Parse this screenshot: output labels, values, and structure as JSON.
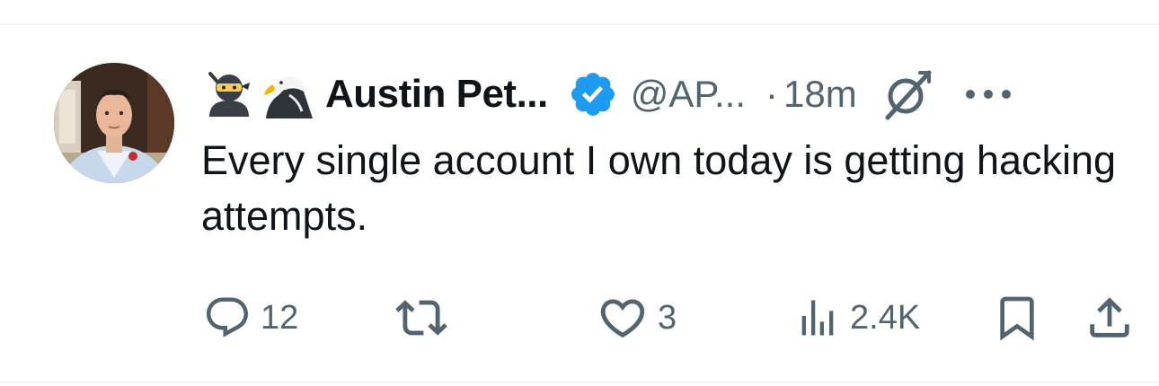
{
  "tweet": {
    "display_name": "Austin Pet...",
    "handle": "@AP...",
    "separator": "·",
    "time": "18m",
    "text": "Every single account I own today is getting hacking attempts.",
    "name_emojis": [
      "ninja-emoji",
      "eagle-emoji"
    ],
    "verified": true
  },
  "actions": {
    "replies": "12",
    "retweets": "",
    "likes": "3",
    "views": "2.4K"
  },
  "icons": [
    "avatar",
    "ninja-icon",
    "eagle-icon",
    "verified-badge-icon",
    "grok-icon",
    "more-icon",
    "reply-icon",
    "retweet-icon",
    "like-icon",
    "views-icon",
    "bookmark-icon",
    "share-icon"
  ],
  "colors": {
    "text": "#0f1419",
    "secondary": "#536471",
    "verified": "#1d9bf0",
    "divider": "#eff3f4"
  }
}
